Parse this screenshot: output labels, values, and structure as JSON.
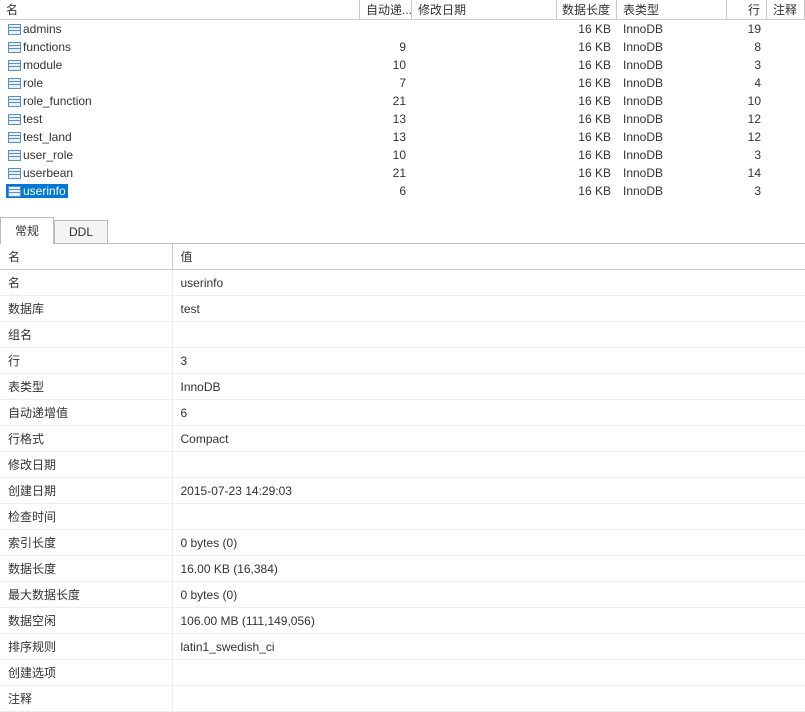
{
  "tables_header": {
    "name": "名",
    "auto_inc": "自动递...",
    "modify_date": "修改日期",
    "data_len": "数据长度",
    "table_type": "表类型",
    "rows": "行",
    "comment": "注释"
  },
  "tables": [
    {
      "name": "admins",
      "auto_inc": "",
      "data_len": "16 KB",
      "table_type": "InnoDB",
      "rows": "19",
      "selected": false
    },
    {
      "name": "functions",
      "auto_inc": "9",
      "data_len": "16 KB",
      "table_type": "InnoDB",
      "rows": "8",
      "selected": false
    },
    {
      "name": "module",
      "auto_inc": "10",
      "data_len": "16 KB",
      "table_type": "InnoDB",
      "rows": "3",
      "selected": false
    },
    {
      "name": "role",
      "auto_inc": "7",
      "data_len": "16 KB",
      "table_type": "InnoDB",
      "rows": "4",
      "selected": false
    },
    {
      "name": "role_function",
      "auto_inc": "21",
      "data_len": "16 KB",
      "table_type": "InnoDB",
      "rows": "10",
      "selected": false
    },
    {
      "name": "test",
      "auto_inc": "13",
      "data_len": "16 KB",
      "table_type": "InnoDB",
      "rows": "12",
      "selected": false
    },
    {
      "name": "test_land",
      "auto_inc": "13",
      "data_len": "16 KB",
      "table_type": "InnoDB",
      "rows": "12",
      "selected": false
    },
    {
      "name": "user_role",
      "auto_inc": "10",
      "data_len": "16 KB",
      "table_type": "InnoDB",
      "rows": "3",
      "selected": false
    },
    {
      "name": "userbean",
      "auto_inc": "21",
      "data_len": "16 KB",
      "table_type": "InnoDB",
      "rows": "14",
      "selected": false
    },
    {
      "name": "userinfo",
      "auto_inc": "6",
      "data_len": "16 KB",
      "table_type": "InnoDB",
      "rows": "3",
      "selected": true
    }
  ],
  "tabs": {
    "general": "常规",
    "ddl": "DDL"
  },
  "detail_header": {
    "name_col": "名",
    "value_col": "值"
  },
  "details": [
    {
      "label": "名",
      "value": "userinfo"
    },
    {
      "label": "数据库",
      "value": "test"
    },
    {
      "label": "组名",
      "value": ""
    },
    {
      "label": "行",
      "value": "3"
    },
    {
      "label": "表类型",
      "value": "InnoDB"
    },
    {
      "label": "自动递增值",
      "value": "6"
    },
    {
      "label": "行格式",
      "value": "Compact"
    },
    {
      "label": "修改日期",
      "value": ""
    },
    {
      "label": "创建日期",
      "value": "2015-07-23 14:29:03"
    },
    {
      "label": "检查时间",
      "value": ""
    },
    {
      "label": "索引长度",
      "value": "0 bytes (0)"
    },
    {
      "label": "数据长度",
      "value": "16.00 KB (16,384)"
    },
    {
      "label": "最大数据长度",
      "value": "0 bytes (0)"
    },
    {
      "label": "数据空闲",
      "value": "106.00 MB (111,149,056)"
    },
    {
      "label": "排序规则",
      "value": "latin1_swedish_ci"
    },
    {
      "label": "创建选项",
      "value": ""
    },
    {
      "label": "注释",
      "value": ""
    }
  ]
}
